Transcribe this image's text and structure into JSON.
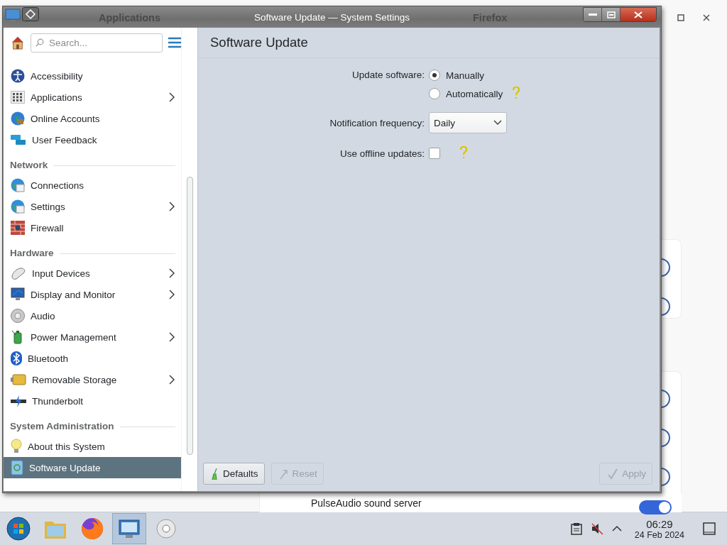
{
  "background_window": {
    "row_label": "PulseAudio sound server",
    "row_toggle_on": true
  },
  "ghost_titles": [
    "Applications",
    "Firefox"
  ],
  "window": {
    "title": "Software Update — System Settings"
  },
  "sidebar": {
    "search_placeholder": "Search...",
    "groups": [
      {
        "items": [
          {
            "label": "Accessibility",
            "chevron": false,
            "selected": false
          },
          {
            "label": "Applications",
            "chevron": true,
            "selected": false
          },
          {
            "label": "Online Accounts",
            "chevron": false,
            "selected": false
          },
          {
            "label": "User Feedback",
            "chevron": false,
            "selected": false
          }
        ]
      },
      {
        "heading": "Network",
        "items": [
          {
            "label": "Connections",
            "chevron": false,
            "selected": false
          },
          {
            "label": "Settings",
            "chevron": true,
            "selected": false
          },
          {
            "label": "Firewall",
            "chevron": false,
            "selected": false
          }
        ]
      },
      {
        "heading": "Hardware",
        "items": [
          {
            "label": "Input Devices",
            "chevron": true,
            "selected": false
          },
          {
            "label": "Display and Monitor",
            "chevron": true,
            "selected": false
          },
          {
            "label": "Audio",
            "chevron": false,
            "selected": false
          },
          {
            "label": "Power Management",
            "chevron": true,
            "selected": false
          },
          {
            "label": "Bluetooth",
            "chevron": false,
            "selected": false
          },
          {
            "label": "Removable Storage",
            "chevron": true,
            "selected": false
          },
          {
            "label": "Thunderbolt",
            "chevron": false,
            "selected": false
          }
        ]
      },
      {
        "heading": "System Administration",
        "items": [
          {
            "label": "About this System",
            "chevron": false,
            "selected": false
          },
          {
            "label": "Software Update",
            "chevron": false,
            "selected": true
          }
        ]
      }
    ]
  },
  "page": {
    "title": "Software Update",
    "update_software": {
      "label": "Update software:",
      "options": [
        {
          "label": "Manually",
          "selected": true,
          "help": false
        },
        {
          "label": "Automatically",
          "selected": false,
          "help": true
        }
      ]
    },
    "notification_frequency": {
      "label": "Notification frequency:",
      "value": "Daily"
    },
    "offline_updates": {
      "label": "Use offline updates:",
      "checked": false,
      "help": true
    },
    "buttons": [
      {
        "kind": "defaults",
        "label": "Defaults",
        "disabled": false
      },
      {
        "kind": "reset",
        "label": "Reset",
        "disabled": true
      },
      {
        "kind": "apply",
        "label": "Apply",
        "disabled": true
      }
    ]
  },
  "taskbar": {
    "apps": [
      {
        "kind": "start",
        "active": false
      },
      {
        "kind": "files",
        "active": false
      },
      {
        "kind": "browser",
        "active": false
      },
      {
        "kind": "settings",
        "active": true
      },
      {
        "kind": "disc",
        "active": false
      }
    ],
    "time": "06:29",
    "date": "24 Feb 2024"
  }
}
